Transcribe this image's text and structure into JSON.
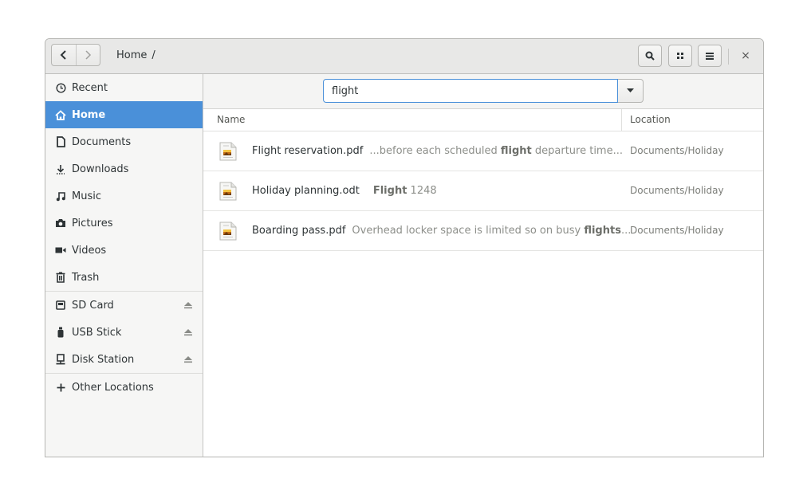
{
  "header": {
    "breadcrumb": "Home",
    "breadcrumb_sep": "/",
    "close_label": "×"
  },
  "sidebar": {
    "items": [
      {
        "label": "Recent",
        "icon": "clock-icon"
      },
      {
        "label": "Home",
        "icon": "home-icon",
        "active": true
      },
      {
        "label": "Documents",
        "icon": "document-icon"
      },
      {
        "label": "Downloads",
        "icon": "download-icon"
      },
      {
        "label": "Music",
        "icon": "music-icon"
      },
      {
        "label": "Pictures",
        "icon": "camera-icon"
      },
      {
        "label": "Videos",
        "icon": "video-icon"
      },
      {
        "label": "Trash",
        "icon": "trash-icon"
      }
    ],
    "devices": [
      {
        "label": "SD Card",
        "icon": "sd-card-icon"
      },
      {
        "label": "USB Stick",
        "icon": "usb-icon"
      },
      {
        "label": "Disk Station",
        "icon": "network-drive-icon"
      }
    ],
    "other_locations": "Other Locations"
  },
  "search": {
    "value": "flight"
  },
  "columns": {
    "name": "Name",
    "location": "Location"
  },
  "results": [
    {
      "name": "Flight reservation.pdf",
      "snip_pre": "...before each scheduled ",
      "snip_bold": "flight",
      "snip_post": " departure time...",
      "location": "Documents/Holiday"
    },
    {
      "name": "Holiday planning.odt",
      "snip_pre": "",
      "snip_bold": "Flight",
      "snip_post": " 1248",
      "location": "Documents/Holiday"
    },
    {
      "name": "Boarding pass.pdf",
      "snip_pre": "Overhead locker space is limited so on busy ",
      "snip_bold": "flights",
      "snip_post": "...",
      "location": "Documents/Holiday"
    }
  ],
  "colors": {
    "accent": "#4a90d9"
  }
}
